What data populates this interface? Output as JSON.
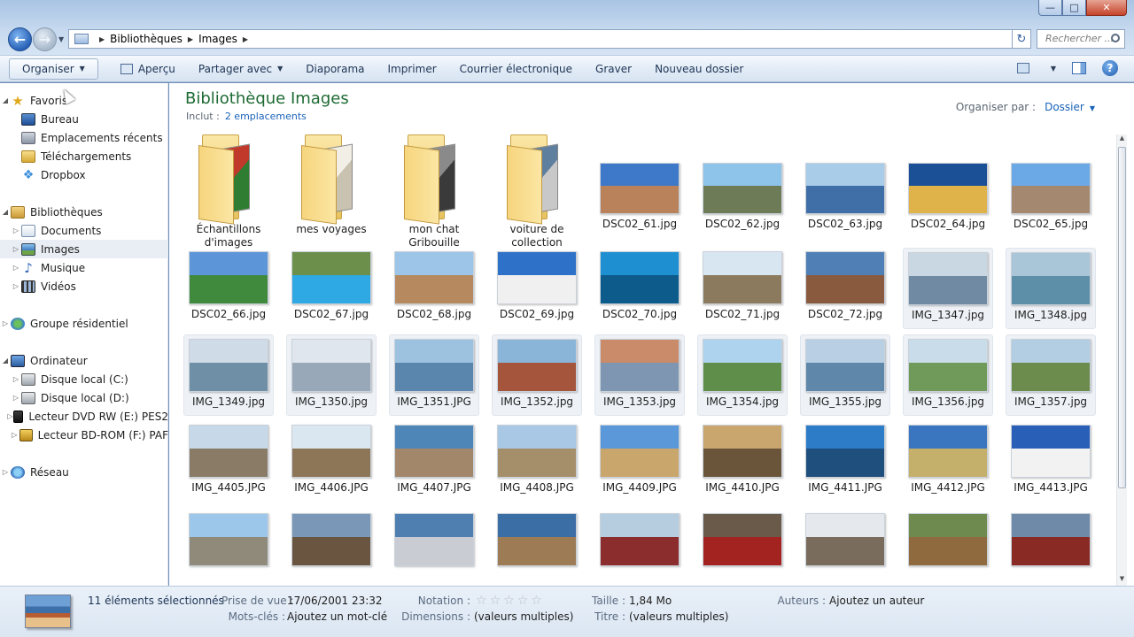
{
  "window": {
    "min": "—",
    "max": "□",
    "close": "✕"
  },
  "address": {
    "crumbs": [
      "Bibliothèques",
      "Images"
    ],
    "search_placeholder": "Rechercher ..."
  },
  "toolbar": {
    "organize": "Organiser",
    "preview": "Aperçu",
    "share": "Partager avec",
    "slideshow": "Diaporama",
    "print": "Imprimer",
    "email": "Courrier électronique",
    "burn": "Graver",
    "new_folder": "Nouveau dossier"
  },
  "sidebar": {
    "favorites": "Favoris",
    "desktop": "Bureau",
    "recent": "Emplacements récents",
    "downloads": "Téléchargements",
    "dropbox": "Dropbox",
    "libraries": "Bibliothèques",
    "documents": "Documents",
    "images": "Images",
    "music": "Musique",
    "videos": "Vidéos",
    "homegroup": "Groupe résidentiel",
    "computer": "Ordinateur",
    "disk_c": "Disque local (C:)",
    "disk_d": "Disque local (D:)",
    "dvd": "Lecteur DVD RW (E:) PES2",
    "bd": "Lecteur BD-ROM (F:) PAF",
    "network": "Réseau"
  },
  "main": {
    "title": "Bibliothèque Images",
    "included_label": "Inclut :",
    "included_link": "2 emplacements",
    "arrange_label": "Organiser par :",
    "arrange_value": "Dossier"
  },
  "items": [
    {
      "label": "Échantillons d'images",
      "kind": "folder",
      "colors": [
        "#c0392b",
        "#2e7d32"
      ]
    },
    {
      "label": "mes voyages",
      "kind": "folder",
      "colors": [
        "#f2efe6",
        "#c9c2b0"
      ]
    },
    {
      "label": "mon chat Gribouille",
      "kind": "folder",
      "colors": [
        "#8a8a8a",
        "#3a3a3a"
      ]
    },
    {
      "label": "voiture de collection",
      "kind": "folder",
      "colors": [
        "#5f7f9f",
        "#c8c8c8"
      ]
    },
    {
      "label": "DSC02_61.jpg",
      "colors": [
        "#3d78c9",
        "#b9825a"
      ]
    },
    {
      "label": "DSC02_62.jpg",
      "colors": [
        "#8ec3ea",
        "#6d7b57"
      ]
    },
    {
      "label": "DSC02_63.jpg",
      "colors": [
        "#a9cde9",
        "#3f6fa6"
      ]
    },
    {
      "label": "DSC02_64.jpg",
      "colors": [
        "#1b4f96",
        "#e0b24a"
      ]
    },
    {
      "label": "DSC02_65.jpg",
      "colors": [
        "#6aa9e6",
        "#a58870"
      ]
    },
    {
      "label": "DSC02_66.jpg",
      "colors": [
        "#5d96d8",
        "#3f8a3c"
      ]
    },
    {
      "label": "DSC02_67.jpg",
      "colors": [
        "#6c8f4b",
        "#2fa9e4"
      ]
    },
    {
      "label": "DSC02_68.jpg",
      "colors": [
        "#9cc5e8",
        "#b6895e"
      ]
    },
    {
      "label": "DSC02_69.jpg",
      "colors": [
        "#2d72c8",
        "#f0f0f0"
      ]
    },
    {
      "label": "DSC02_70.jpg",
      "colors": [
        "#1e8fd0",
        "#0d5b8a"
      ]
    },
    {
      "label": "DSC02_71.jpg",
      "colors": [
        "#d8e6f2",
        "#8c7a5e"
      ]
    },
    {
      "label": "DSC02_72.jpg",
      "colors": [
        "#4f7fb5",
        "#8a5a3e"
      ]
    },
    {
      "label": "IMG_1347.jpg",
      "colors": [
        "#c9d7e3",
        "#6f8aa2"
      ],
      "selected": true
    },
    {
      "label": "IMG_1348.jpg",
      "colors": [
        "#a9c6d8",
        "#5d8fa8"
      ],
      "selected": true
    },
    {
      "label": "IMG_1349.jpg",
      "colors": [
        "#cfdbe6",
        "#6f8fa6"
      ],
      "selected": true
    },
    {
      "label": "IMG_1350.jpg",
      "colors": [
        "#dfe6ee",
        "#98a8b8"
      ],
      "selected": true
    },
    {
      "label": "IMG_1351.JPG",
      "colors": [
        "#9cc2e0",
        "#5a85ac"
      ],
      "selected": true
    },
    {
      "label": "IMG_1352.jpg",
      "colors": [
        "#8ab5d8",
        "#a5553b"
      ],
      "selected": true
    },
    {
      "label": "IMG_1353.jpg",
      "colors": [
        "#c98b6a",
        "#7e96b2"
      ],
      "selected": true
    },
    {
      "label": "IMG_1354.jpg",
      "colors": [
        "#aed3ee",
        "#5f8e4a"
      ],
      "selected": true
    },
    {
      "label": "IMG_1355.jpg",
      "colors": [
        "#b9d0e4",
        "#5f87a9"
      ],
      "selected": true
    },
    {
      "label": "IMG_1356.jpg",
      "colors": [
        "#c9dcea",
        "#6f9a5a"
      ],
      "selected": true
    },
    {
      "label": "IMG_1357.jpg",
      "colors": [
        "#b3cde2",
        "#6b8c4c"
      ],
      "selected": true
    },
    {
      "label": "IMG_4405.JPG",
      "colors": [
        "#c7d9e8",
        "#8a7b66"
      ]
    },
    {
      "label": "IMG_4406.JPG",
      "colors": [
        "#dbe7f0",
        "#8d7558"
      ]
    },
    {
      "label": "IMG_4407.JPG",
      "colors": [
        "#4f86b8",
        "#a2876a"
      ]
    },
    {
      "label": "IMG_4408.JPG",
      "colors": [
        "#a8c8e6",
        "#a58f6b"
      ]
    },
    {
      "label": "IMG_4409.JPG",
      "colors": [
        "#5a98d9",
        "#c9a66b"
      ]
    },
    {
      "label": "IMG_4410.JPG",
      "colors": [
        "#c8a66e",
        "#6b553a"
      ]
    },
    {
      "label": "IMG_4411.JPG",
      "colors": [
        "#2c7cc7",
        "#1f4f7c"
      ]
    },
    {
      "label": "IMG_4412.JPG",
      "colors": [
        "#3a76c0",
        "#c4b06a"
      ]
    },
    {
      "label": "IMG_4413.JPG",
      "colors": [
        "#2a5fb8",
        "#f2f2f2"
      ]
    },
    {
      "label": "",
      "colors": [
        "#9cc6ea",
        "#8f8a7a"
      ]
    },
    {
      "label": "",
      "colors": [
        "#7a97b8",
        "#6a5640"
      ]
    },
    {
      "label": "",
      "colors": [
        "#4f7fb0",
        "#c9ccd2"
      ]
    },
    {
      "label": "",
      "colors": [
        "#3c6ea6",
        "#9c7b55"
      ]
    },
    {
      "label": "",
      "colors": [
        "#b6cde0",
        "#8b2d2d"
      ]
    },
    {
      "label": "",
      "colors": [
        "#6a5a4a",
        "#a2231f"
      ]
    },
    {
      "label": "",
      "colors": [
        "#e5e9ee",
        "#7a6c5c"
      ]
    },
    {
      "label": "",
      "colors": [
        "#6e8a4e",
        "#8e6a3e"
      ]
    },
    {
      "label": "",
      "colors": [
        "#6e8aa8",
        "#8a2a24"
      ]
    }
  ],
  "details": {
    "count": "11 éléments sélectionnés",
    "date_label": "Prise de vue :",
    "date_value": "17/06/2001 23:32",
    "keywords_label": "Mots-clés :",
    "keywords_value": "Ajoutez un mot-clé",
    "rating_label": "Notation :",
    "rating": 0,
    "dimensions_label": "Dimensions :",
    "dimensions_value": "(valeurs multiples)",
    "size_label": "Taille :",
    "size_value": "1,84 Mo",
    "title_label": "Titre :",
    "title_value": "(valeurs multiples)",
    "authors_label": "Auteurs :",
    "authors_value": "Ajoutez un auteur"
  }
}
